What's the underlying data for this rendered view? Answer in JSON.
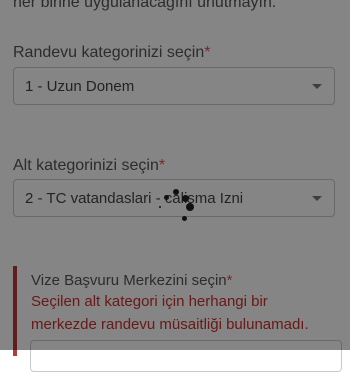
{
  "top_note": "her birine uygulanacağını unutmayın.",
  "category": {
    "label": "Randevu kategorinizi seçin",
    "required_mark": "*",
    "selected": "1 - Uzun Donem"
  },
  "subcategory": {
    "label": "Alt kategorinizi seçin",
    "required_mark": "*",
    "selected": "2 - TC vatandaslari - calisma Izni"
  },
  "visa_center": {
    "label": "Vize Başvuru Merkezini seçin",
    "required_mark": "*",
    "error_line1": "Seçilen alt kategori için herhangi bir",
    "error_line2": "merkezde randevu müsaitliği bulunamadı."
  },
  "loading": {
    "state": "loading"
  },
  "colors": {
    "required": "#d9534f",
    "error": "#c9302c",
    "alert_border": "#b53b3b"
  }
}
